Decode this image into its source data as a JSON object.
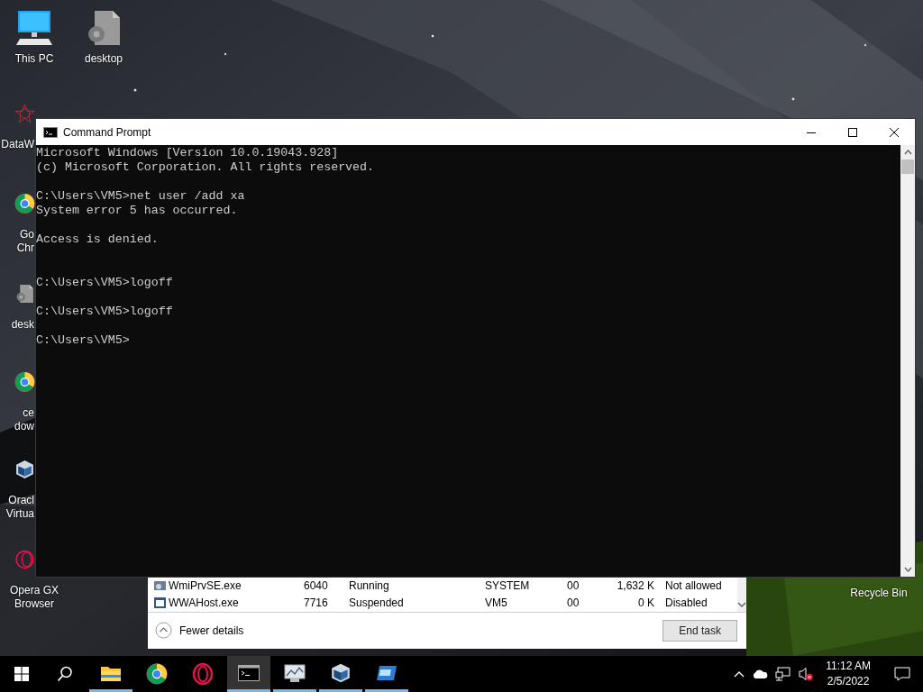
{
  "desktop_icons": [
    {
      "kind": "pc",
      "lines": [
        "This PC"
      ],
      "cut": false
    },
    {
      "kind": "file",
      "lines": [
        "desktop"
      ],
      "cut": false
    },
    {
      "kind": "datawrapper",
      "lines": [
        "DataW"
      ],
      "cut": true
    },
    {
      "kind": "chrome",
      "lines": [
        "Go",
        "Chr"
      ],
      "cut": true
    },
    {
      "kind": "file",
      "lines": [
        "desk"
      ],
      "cut": true
    },
    {
      "kind": "chrome",
      "lines": [
        "ce",
        "dow"
      ],
      "cut": true
    },
    {
      "kind": "virtualbox",
      "lines": [
        "Oracl",
        "Virtua"
      ],
      "cut": true
    },
    {
      "kind": "opera",
      "lines": [
        "Opera GX",
        "Browser"
      ],
      "cut": false
    }
  ],
  "recycle_bin": {
    "label": "Recycle Bin"
  },
  "task_manager": {
    "rows": [
      {
        "name": "WmiPrvSE.exe",
        "pid": "6040",
        "status": "Running",
        "user": "SYSTEM",
        "cpu": "00",
        "memory": "1,632 K",
        "uac": "Not allowed"
      },
      {
        "name": "WWAHost.exe",
        "pid": "7716",
        "status": "Suspended",
        "user": "VM5",
        "cpu": "00",
        "memory": "0 K",
        "uac": "Disabled"
      }
    ],
    "fewer_details": "Fewer details",
    "end_task": "End task"
  },
  "console": {
    "title": "Command Prompt",
    "lines": [
      {
        "kind": "text",
        "text": "Microsoft Windows [Version 10.0.19043.928]"
      },
      {
        "kind": "text",
        "text": "(c) Microsoft Corporation. All rights reserved."
      },
      {
        "kind": "blank"
      },
      {
        "kind": "text",
        "text": "C:\\Users\\VM5>net user /add xa"
      },
      {
        "kind": "text",
        "text": "System error 5 has occurred."
      },
      {
        "kind": "blank"
      },
      {
        "kind": "text",
        "text": "Access is denied."
      },
      {
        "kind": "blank"
      },
      {
        "kind": "blank"
      },
      {
        "kind": "text",
        "text": "C:\\Users\\VM5>logoff"
      },
      {
        "kind": "blank"
      },
      {
        "kind": "text",
        "text": "C:\\Users\\VM5>logoff"
      },
      {
        "kind": "blank"
      },
      {
        "kind": "text",
        "text": "C:\\Users\\VM5>"
      }
    ]
  },
  "taskbar": {
    "apps": [
      {
        "kind": "explorer",
        "running": true,
        "active": false
      },
      {
        "kind": "chrome",
        "running": false,
        "active": false
      },
      {
        "kind": "opera",
        "running": false,
        "active": false
      },
      {
        "kind": "cmd",
        "running": true,
        "active": true
      },
      {
        "kind": "taskmgr",
        "running": true,
        "active": false
      },
      {
        "kind": "virtualbox",
        "running": true,
        "active": false
      },
      {
        "kind": "app",
        "running": true,
        "active": false
      }
    ],
    "volume_muted": true,
    "time": "11:12 AM",
    "date": "2/5/2022"
  }
}
